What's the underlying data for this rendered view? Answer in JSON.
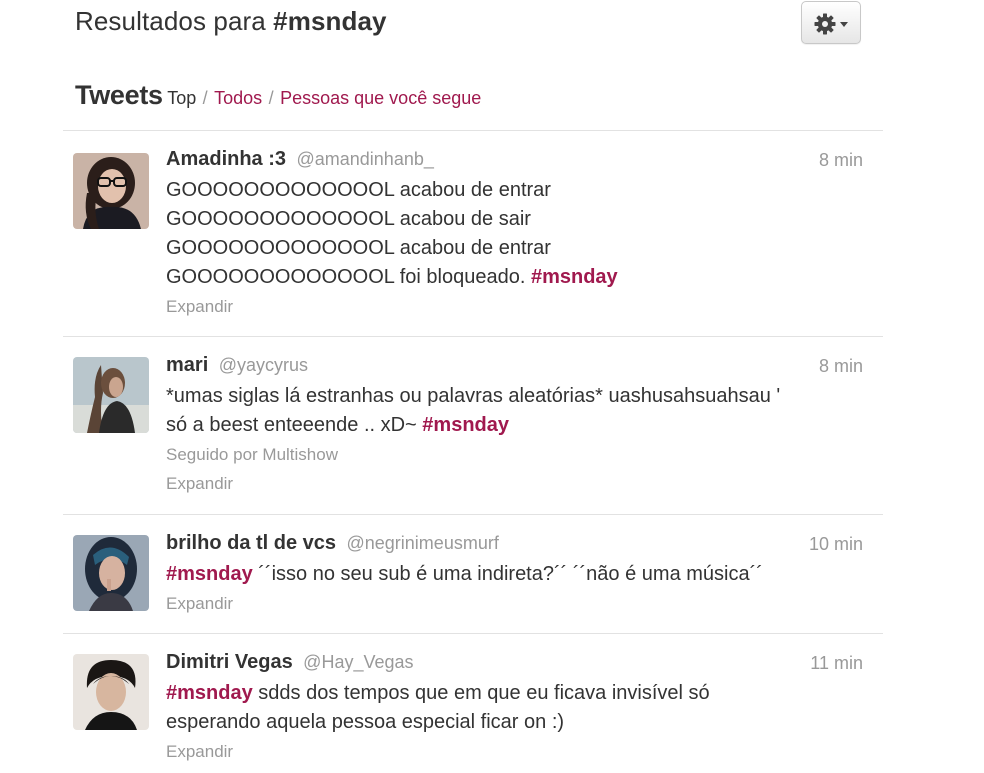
{
  "header": {
    "title_prefix": "Resultados para ",
    "title_query": "#msnday",
    "settings_icon": "gear-icon",
    "settings_caret_icon": "chevron-down-icon"
  },
  "nav": {
    "heading": "Tweets",
    "filters": [
      "Top",
      "Todos",
      "Pessoas que você segue"
    ],
    "separator": "/"
  },
  "colors": {
    "link": "#a0194e",
    "muted": "#999999",
    "text": "#333333"
  },
  "tweets": [
    {
      "fullname": "Amadinha :3",
      "username": "@amandinhanb_",
      "time": "8 min",
      "lines": [
        "GOOOOOOOOOOOOOL acabou de entrar",
        "GOOOOOOOOOOOOOL acabou de sair",
        "GOOOOOOOOOOOOOL acabou de entrar"
      ],
      "last_line": "GOOOOOOOOOOOOOL foi bloqueado. ",
      "hashtag": "#msnday",
      "expand": "Expandir"
    },
    {
      "fullname": "mari",
      "username": "@yaycyrus",
      "time": "8 min",
      "line1": "*umas siglas lá estranhas ou palavras aleatórias* uashusahsuahsau '",
      "line2": "só a beest enteeende .. xD~ ",
      "hashtag": "#msnday",
      "followed_by": "Seguido por Multishow",
      "expand": "Expandir"
    },
    {
      "fullname": "brilho da tl de vcs",
      "username": "@negrinimeusmurf",
      "time": "10 min",
      "hashtag": "#msnday",
      "text": " ´´isso no seu sub é uma indireta?´´ ´´não é uma música´´",
      "expand": "Expandir"
    },
    {
      "fullname": "Dimitri Vegas",
      "username": "@Hay_Vegas",
      "time": "11 min",
      "hashtag": "#msnday",
      "text1": " sdds dos tempos que em que eu ficava invisível só",
      "text2": "esperando aquela pessoa especial ficar on :)",
      "expand": "Expandir"
    }
  ]
}
